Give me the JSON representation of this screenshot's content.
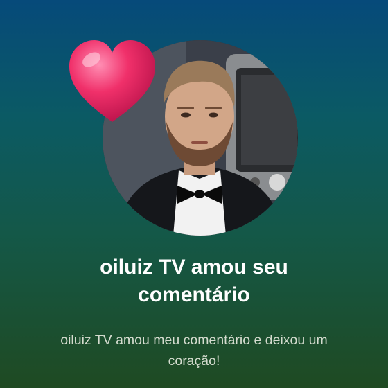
{
  "notification": {
    "title": "oiluiz TV amou seu comentário",
    "message": "oiluiz TV amou meu comentário e deixou um coração!"
  },
  "avatar": {
    "icon": "profile-photo"
  },
  "reaction": {
    "icon": "heart-icon",
    "color": "#f0306a"
  },
  "colors": {
    "background_top": "#064a7a",
    "background_bottom": "#1f4a22",
    "title": "#ffffff",
    "message": "#d5dccf"
  }
}
